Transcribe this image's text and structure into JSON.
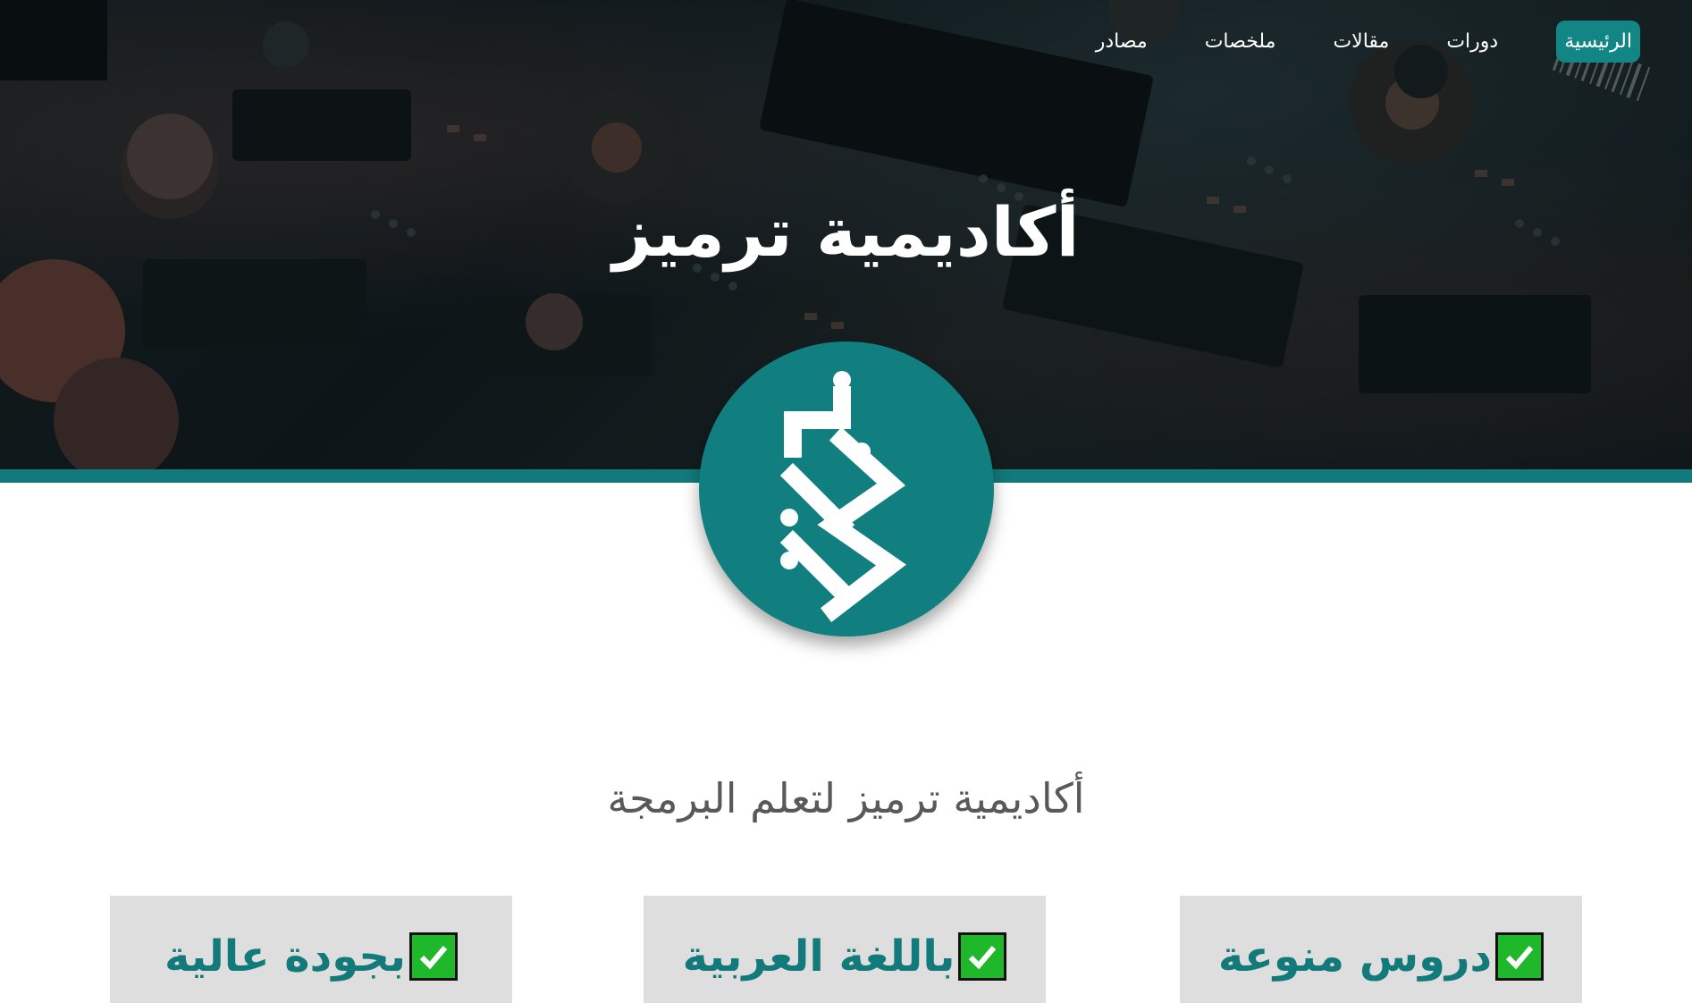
{
  "nav": {
    "items": [
      {
        "label": "الرئيسية",
        "active": true
      },
      {
        "label": "دورات",
        "active": false
      },
      {
        "label": "مقالات",
        "active": false
      },
      {
        "label": "ملخصات",
        "active": false
      },
      {
        "label": "مصادر",
        "active": false
      }
    ]
  },
  "hero": {
    "title": "أكاديمية ترميز"
  },
  "logo": {
    "icon": "tarmeez-logo-icon"
  },
  "tagline": "أكاديمية ترميز لتعلم البرمجة",
  "features": [
    {
      "label": "دروس منوعة",
      "icon": "check-mark-icon"
    },
    {
      "label": "باللغة العربية",
      "icon": "check-mark-icon"
    },
    {
      "label": "بجودة عالية",
      "icon": "check-mark-icon"
    }
  ],
  "colors": {
    "accent": "#127a7a",
    "check": "#1fb82a",
    "card_bg": "#dedede",
    "tagline": "#595959"
  }
}
